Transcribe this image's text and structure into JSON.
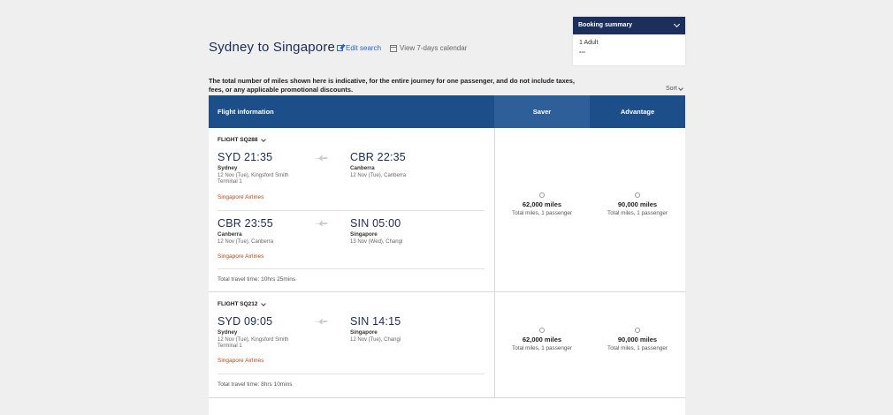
{
  "header": {
    "title": "Sydney to Singapore",
    "edit_search": "Edit search",
    "view_calendar": "View 7-days calendar"
  },
  "booking_summary": {
    "title": "Booking summary",
    "passengers": "1 Adult",
    "total": "---"
  },
  "note": "The total number of miles shown here is indicative, for the entire journey for one passenger, and do not include taxes, fees, or any applicable promotional discounts.",
  "sort_label": "Sort",
  "table_header": {
    "flight_info": "Flight information",
    "saver": "Saver",
    "advantage": "Advantage"
  },
  "flights": [
    {
      "number": "FLIGHT SQ288",
      "segments": [
        {
          "dep_time": "SYD 21:35",
          "dep_city": "Sydney",
          "dep_detail1": "12 Nov (Tue), Kingsford Smith",
          "dep_detail2": "Terminal 1",
          "arr_time": "CBR 22:35",
          "arr_city": "Canberra",
          "arr_detail1": "12 Nov (Tue), Canberra",
          "airline": "Singapore Airlines"
        },
        {
          "dep_time": "CBR 23:55",
          "dep_city": "Canberra",
          "dep_detail1": "12 Nov (Tue), Canberra",
          "arr_time": "SIN 05:00",
          "arr_city": "Singapore",
          "arr_detail1": "13 Nov (Wed), Changi",
          "airline": "Singapore Airlines"
        }
      ],
      "total_time": "Total travel time: 10hrs 25mins",
      "saver": {
        "miles": "62,000 miles",
        "sub": "Total miles, 1 passenger"
      },
      "advantage": {
        "miles": "90,000 miles",
        "sub": "Total miles, 1 passenger"
      }
    },
    {
      "number": "FLIGHT SQ212",
      "segments": [
        {
          "dep_time": "SYD 09:05",
          "dep_city": "Sydney",
          "dep_detail1": "12 Nov (Tue), Kingsford Smith",
          "dep_detail2": "Terminal 1",
          "arr_time": "SIN 14:15",
          "arr_city": "Singapore",
          "arr_detail1": "12 Nov (Tue), Changi",
          "airline": "Singapore Airlines"
        }
      ],
      "total_time": "Total travel time: 8hrs 10mins",
      "saver": {
        "miles": "62,000 miles",
        "sub": "Total miles, 1 passenger"
      },
      "advantage": {
        "miles": "90,000 miles",
        "sub": "Total miles, 1 passenger"
      }
    }
  ]
}
